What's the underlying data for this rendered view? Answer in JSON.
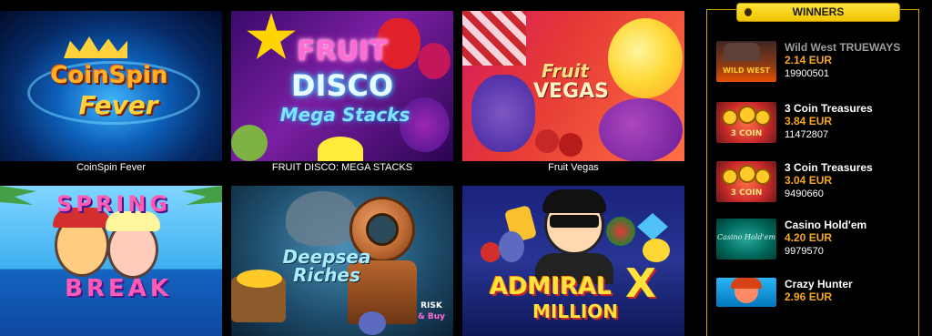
{
  "games": [
    {
      "name": "CoinSpin Fever",
      "thumb_text": [
        "CoinSpin",
        "Fever"
      ]
    },
    {
      "name": "FRUIT DISCO: MEGA STACKS",
      "thumb_text": [
        "FRUIT",
        "DISCO",
        "Mega Stacks"
      ]
    },
    {
      "name": "Fruit Vegas",
      "thumb_text": [
        "Fruit",
        "VEGAS"
      ]
    },
    {
      "name": "Spring Break",
      "thumb_text": [
        "SPRING",
        "BREAK"
      ]
    },
    {
      "name": "Deepsea Riches",
      "thumb_text": [
        "Deepsea",
        "Riches",
        "RISK",
        "& Buy"
      ]
    },
    {
      "name": "Admiral X Million",
      "thumb_text": [
        "ADMIRAL",
        "X",
        "MILLION"
      ]
    }
  ],
  "winners": {
    "title": "WINNERS",
    "items": [
      {
        "game": "Wild West TRUEWAYS",
        "amount": "2.14 EUR",
        "id": "19900501",
        "thumb_text": "WILD WEST"
      },
      {
        "game": "3 Coin Treasures",
        "amount": "3.84 EUR",
        "id": "11472807",
        "thumb_text": "3 COIN"
      },
      {
        "game": "3 Coin Treasures",
        "amount": "3.04 EUR",
        "id": "9490660",
        "thumb_text": "3 COIN"
      },
      {
        "game": "Casino Hold'em",
        "amount": "4.20 EUR",
        "id": "9979570",
        "thumb_text": "Casino Hold'em"
      },
      {
        "game": "Crazy Hunter",
        "amount": "2.96 EUR",
        "id": "",
        "thumb_text": ""
      }
    ]
  },
  "colors": {
    "accent": "#f5c400",
    "amount": "#f5a623",
    "background": "#000000"
  }
}
